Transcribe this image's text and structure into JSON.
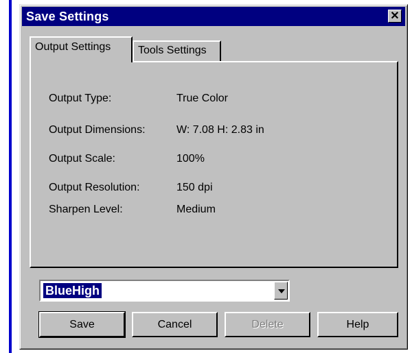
{
  "window": {
    "title": "Save Settings",
    "close_glyph": "✕"
  },
  "tabs": [
    {
      "label": "Output Settings",
      "active": true
    },
    {
      "label": "Tools Settings",
      "active": false
    }
  ],
  "settings": [
    {
      "label": "Output Type:",
      "value": "True Color"
    },
    {
      "label": "Output Dimensions:",
      "value": "W: 7.08 H: 2.83 in"
    },
    {
      "label": "Output Scale:",
      "value": "100%"
    },
    {
      "label": "Output Resolution:",
      "value": "150 dpi"
    },
    {
      "label": "Sharpen Level:",
      "value": "Medium"
    }
  ],
  "preset": {
    "selected": "BlueHigh",
    "icon": "chevron-down-icon"
  },
  "buttons": {
    "save": "Save",
    "cancel": "Cancel",
    "delete": "Delete",
    "help": "Help"
  },
  "colors": {
    "titlebar": "#000080",
    "face": "#c0c0c0",
    "accent_rule": "#0000cc"
  }
}
